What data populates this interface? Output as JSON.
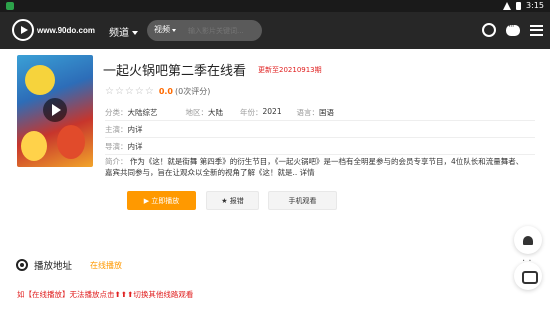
{
  "statusbar": {
    "time": "3:15"
  },
  "navbar": {
    "brand": "www.90do.com",
    "channel_label": "频道",
    "search": {
      "scope": "视频",
      "placeholder": "输入影片关键词..."
    },
    "icons": [
      "history-icon",
      "chat-icon",
      "menu-icon"
    ]
  },
  "movie": {
    "title": "一起火锅吧第二季在线看",
    "update_note": "更新至20210913期",
    "rating": {
      "score": "0.0",
      "count": "(0次评分)"
    },
    "category_label": "分类：",
    "category": "大陆综艺",
    "region_label": "地区：",
    "region": "大陆",
    "year_label": "年份：",
    "year": "2021",
    "language_label": "语言：",
    "language": "国语",
    "cast_label": "主演：",
    "cast": "内详",
    "director_label": "导演：",
    "director": "内详",
    "intro_label": "简介：",
    "intro": "作为《这！就是街舞 第四季》的衍生节目，《一起火锅吧》是一档有全明星参与的会员专享节目，4位队长和流量舞者、嘉宾共同参与，旨在让观众以全新的视角了解《这！就是.. 详情",
    "play_button": "▶ 立即播放",
    "report_button": "★ 报错",
    "mobile_button": "手机观看"
  },
  "play_section": {
    "label": "播放地址",
    "tab": "在线播放",
    "notice": "如【在线播放】无法播放点击⬆⬆⬆切换其他线路观看"
  }
}
